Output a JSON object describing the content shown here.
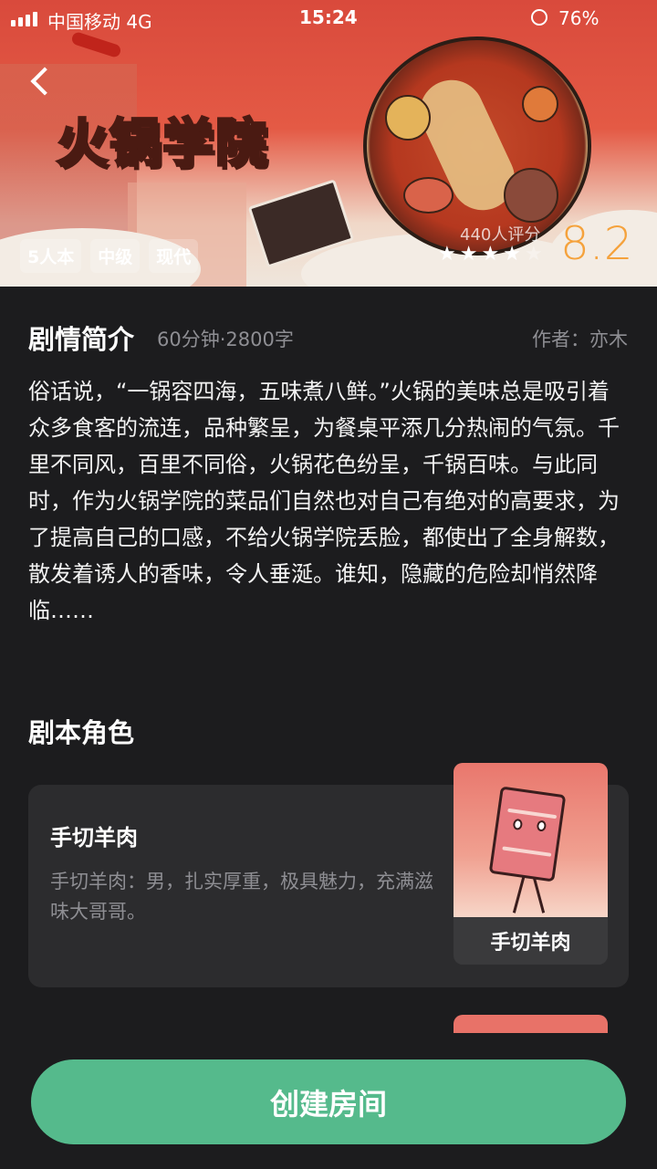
{
  "status_bar": {
    "carrier": "中国移动  4G",
    "time": "15:24",
    "battery": "76%"
  },
  "hero": {
    "logo_text": "火锅学院",
    "tags": [
      "5人本",
      "中级",
      "现代"
    ],
    "rating_count": "440人评分",
    "stars": 4,
    "stars_max": 5,
    "score": "8.2",
    "score_color": "#f5a23c"
  },
  "synopsis": {
    "title": "剧情简介",
    "meta": "60分钟·2800字",
    "author": "作者：亦木",
    "text": "俗话说，“一锅容四海，五味煮八鲜。”火锅的美味总是吸引着众多食客的流连，品种繁呈，为餐桌平添几分热闹的气氛。千里不同风，百里不同俗，火锅花色纷呈，千锅百味。与此同时，作为火锅学院的菜品们自然也对自己有绝对的高要求，为了提高自己的口感，不给火锅学院丢脸，都使出了全身解数，散发着诱人的香味，令人垂涎。谁知，隐藏的危险却悄然降临……"
  },
  "roles": {
    "title": "剧本角色",
    "items": [
      {
        "name": "手切羊肉",
        "description": "手切羊肉：男，扎实厚重，极具魅力，充满滋味大哥哥。",
        "avatar_label": "手切羊肉"
      }
    ]
  },
  "actions": {
    "create_room": "创建房间",
    "accent_color": "#55ba8c"
  }
}
